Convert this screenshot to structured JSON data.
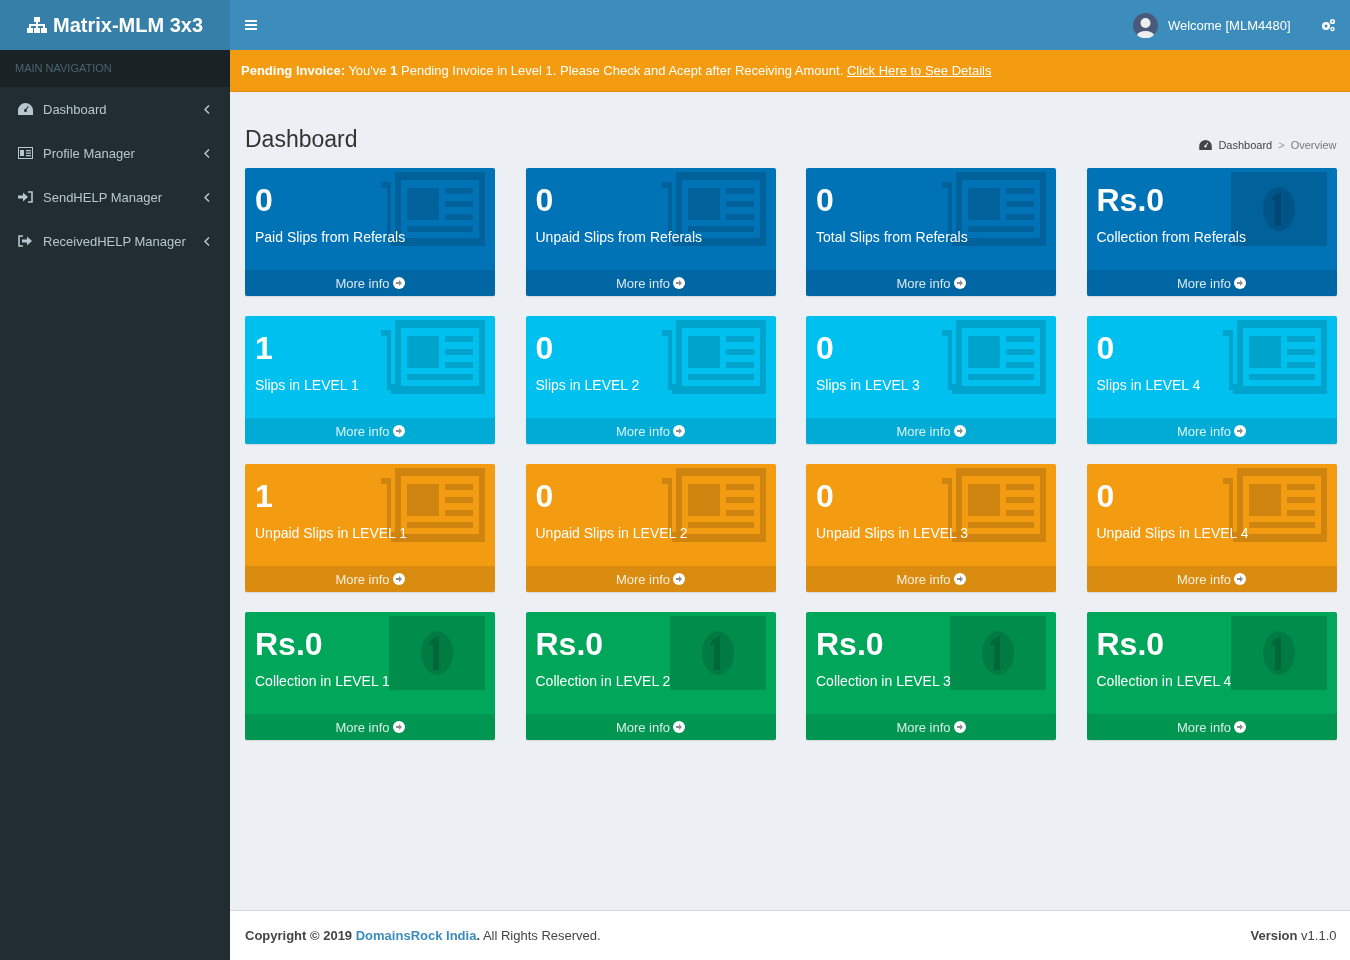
{
  "brand": {
    "title": "Matrix-MLM 3x3"
  },
  "sidebar": {
    "header": "MAIN NAVIGATION",
    "items": [
      {
        "label": "Dashboard",
        "kind": "dashboard"
      },
      {
        "label": "Profile Manager",
        "kind": "profile"
      },
      {
        "label": "SendHELP Manager",
        "kind": "send"
      },
      {
        "label": "ReceivedHELP Manager",
        "kind": "received"
      }
    ]
  },
  "topbar": {
    "user": "Welcome [MLM4480]"
  },
  "alert": {
    "text": "**Pending Invoice:** You've **1** Pending Invoice in Level 1. Please Check and Acept after Receiving Amount.",
    "link": "Click Here to See Details"
  },
  "page": {
    "title": "Dashboard",
    "breadcrumb": [
      "Dashboard",
      "Overview"
    ],
    "breadcrumb_separator": ">"
  },
  "cards": [
    {
      "value": "0",
      "label": "Paid Slips from Referals",
      "kind": "slips",
      "color": "#0073b7",
      "link": "More info"
    },
    {
      "value": "0",
      "label": "Unpaid Slips from Referals",
      "kind": "slips",
      "color": "#0073b7",
      "link": "More info"
    },
    {
      "value": "0",
      "label": "Total Slips from Referals",
      "kind": "slips",
      "color": "#0073b7",
      "link": "More info"
    },
    {
      "value": "Rs.0",
      "label": "Collection from Referals",
      "kind": "money",
      "color": "#0073b7",
      "link": "More info"
    },
    {
      "value": "1",
      "label": "Slips in LEVEL 1",
      "kind": "slips",
      "color": "#00c0ef",
      "link": "More info"
    },
    {
      "value": "0",
      "label": "Slips in LEVEL 2",
      "kind": "slips",
      "color": "#00c0ef",
      "link": "More info"
    },
    {
      "value": "0",
      "label": "Slips in LEVEL 3",
      "kind": "slips",
      "color": "#00c0ef",
      "link": "More info"
    },
    {
      "value": "0",
      "label": "Slips in LEVEL 4",
      "kind": "slips",
      "color": "#00c0ef",
      "link": "More info"
    },
    {
      "value": "1",
      "label": "Unpaid Slips in LEVEL 1",
      "kind": "slips",
      "color": "#f39c12",
      "link": "More info"
    },
    {
      "value": "0",
      "label": "Unpaid Slips in LEVEL 2",
      "kind": "slips",
      "color": "#f39c12",
      "link": "More info"
    },
    {
      "value": "0",
      "label": "Unpaid Slips in LEVEL 3",
      "kind": "slips",
      "color": "#f39c12",
      "link": "More info"
    },
    {
      "value": "0",
      "label": "Unpaid Slips in LEVEL 4",
      "kind": "slips",
      "color": "#f39c12",
      "link": "More info"
    },
    {
      "value": "Rs.0",
      "label": "Collection in LEVEL 1",
      "kind": "money",
      "color": "#00a65a",
      "link": "More info"
    },
    {
      "value": "Rs.0",
      "label": "Collection in LEVEL 2",
      "kind": "money",
      "color": "#00a65a",
      "link": "More info"
    },
    {
      "value": "Rs.0",
      "label": "Collection in LEVEL 3",
      "kind": "money",
      "color": "#00a65a",
      "link": "More info"
    },
    {
      "value": "Rs.0",
      "label": "Collection in LEVEL 4",
      "kind": "money",
      "color": "#00a65a",
      "link": "More info"
    }
  ],
  "footer": {
    "copyright": "**Copyright © 2019**",
    "company": "DomainsRock India",
    "rights": "**.** All Rights Reserved.",
    "version": "**Version** v1.1.0"
  }
}
